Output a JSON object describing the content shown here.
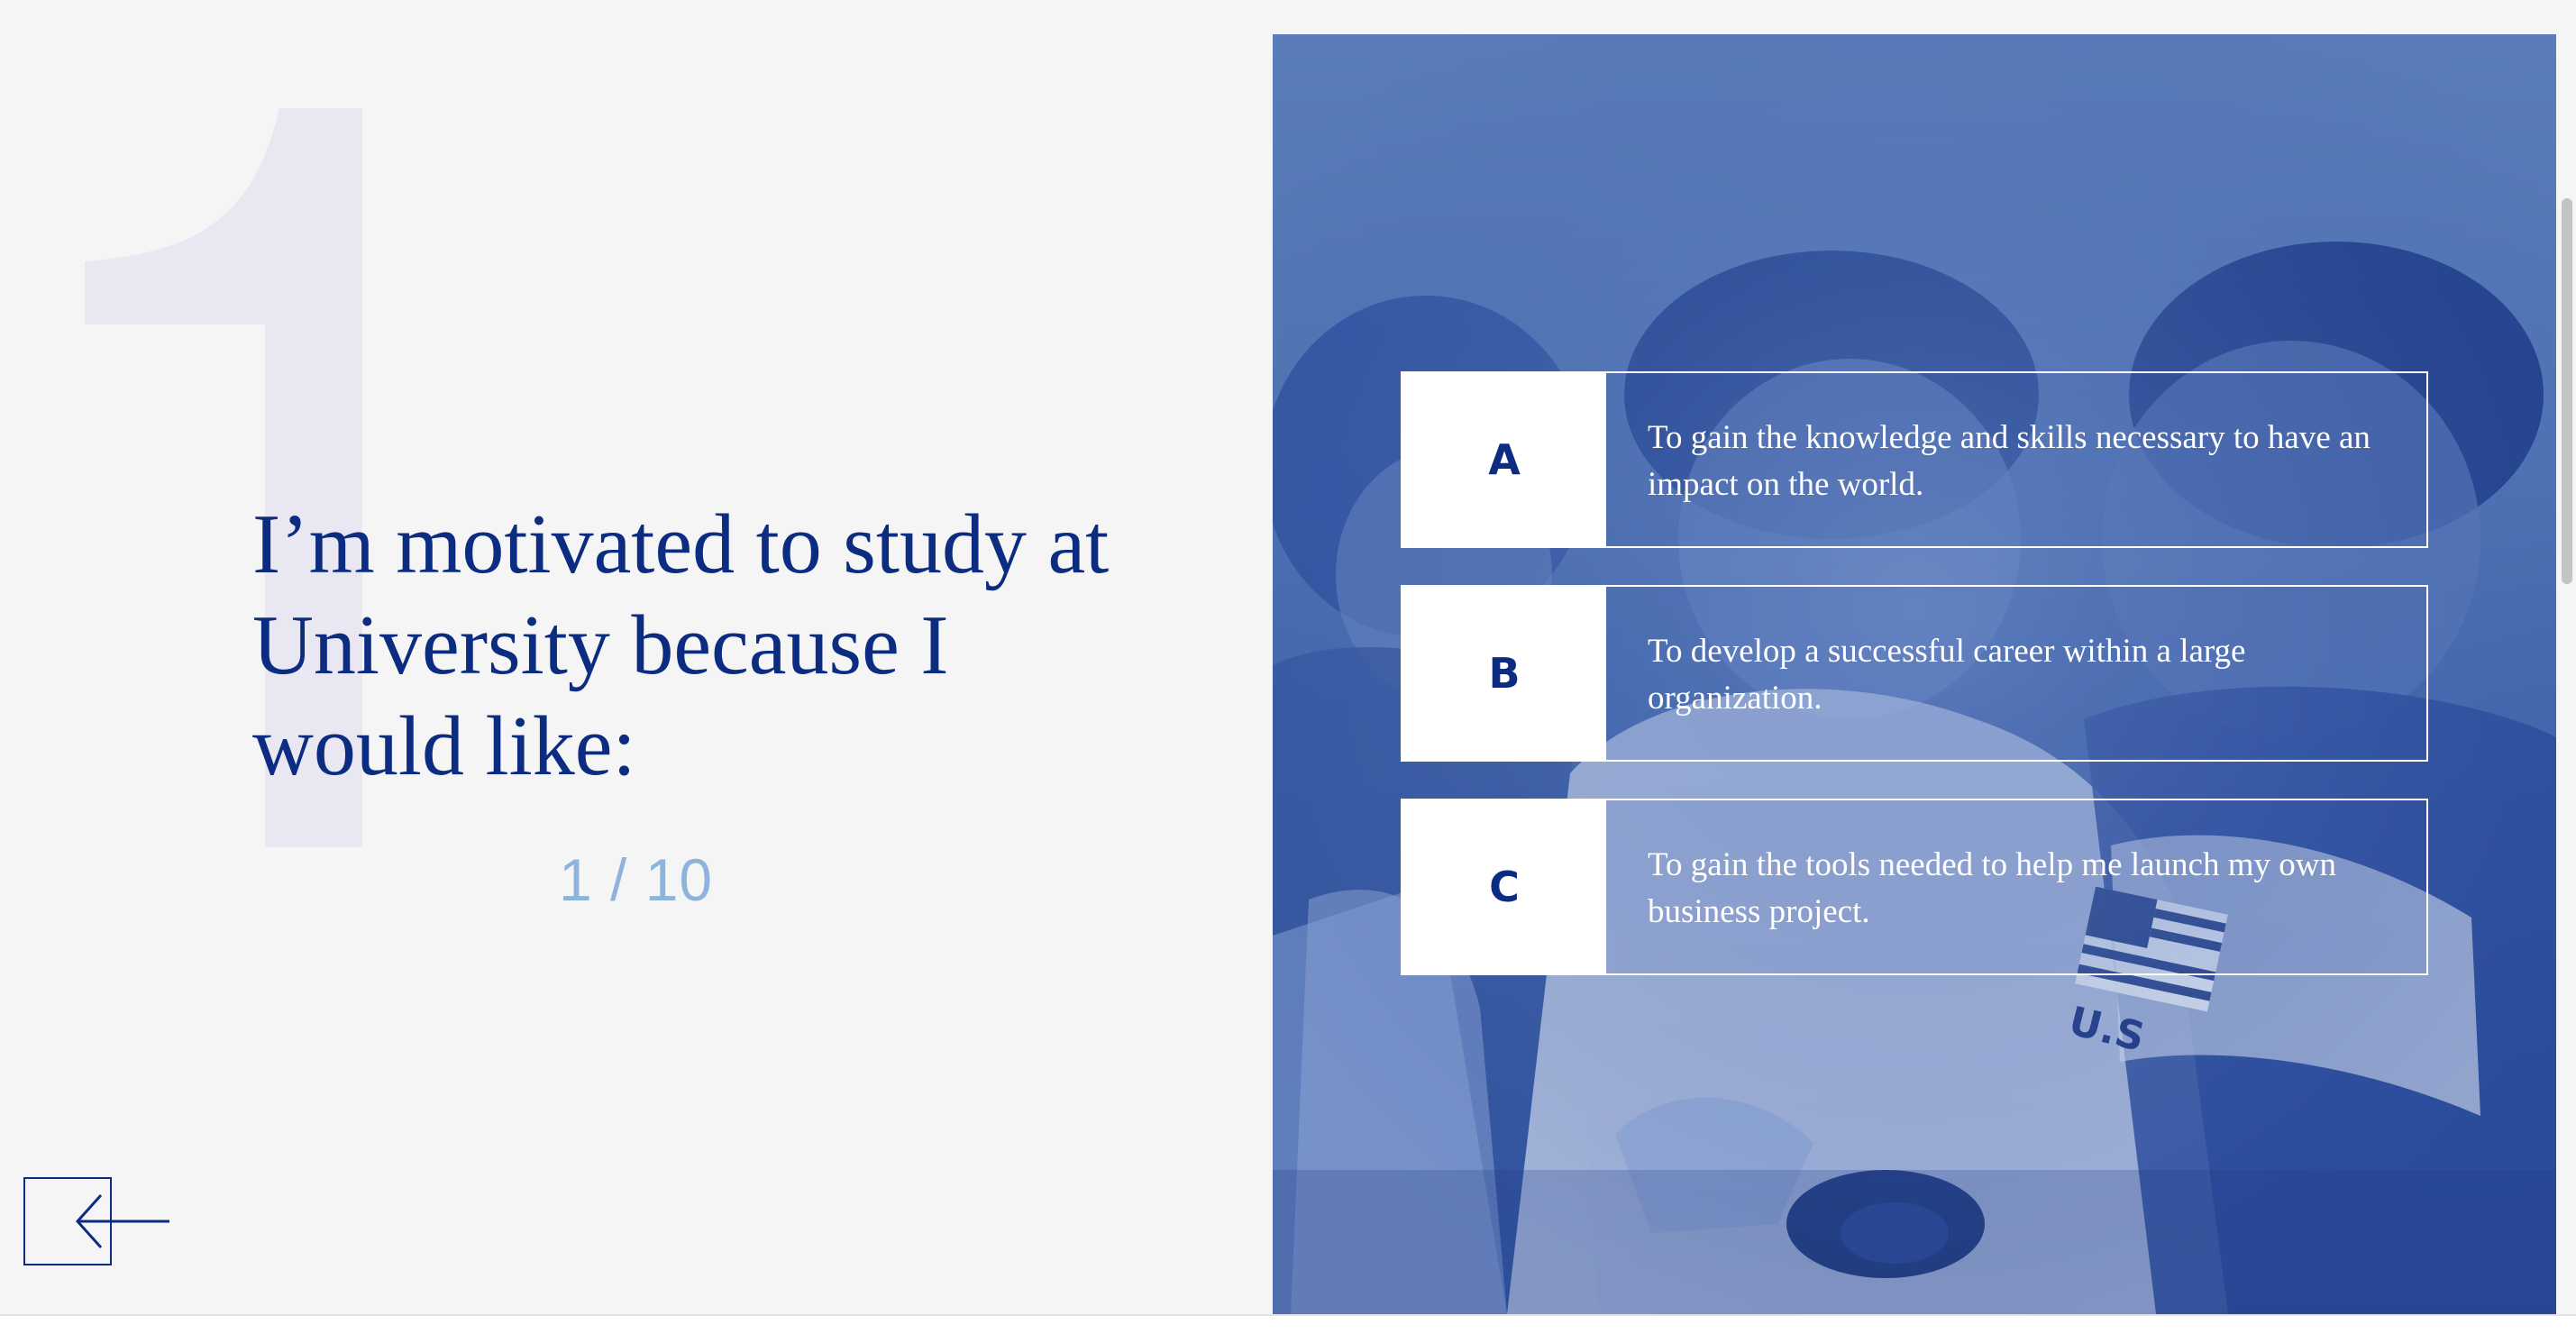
{
  "quiz": {
    "question_number": "1",
    "question_text": "I’m motivated to study at University because I would like:",
    "progress_text": "1 / 10",
    "progress": {
      "current": 1,
      "total": 10
    }
  },
  "navigation": {
    "back_icon": "arrow-left-icon"
  },
  "options": [
    {
      "letter": "A",
      "text": "To gain the knowledge and skills necessary to have an impact on the world."
    },
    {
      "letter": "B",
      "text": "To develop a successful career within a large organization."
    },
    {
      "letter": "C",
      "text": "To gain the tools needed to help me launch my own business project."
    }
  ],
  "colors": {
    "brand_navy": "#0c2c82",
    "photo_tint": "#4f73b4",
    "big_number": "#e9e7f1",
    "progress": "#8fb4dc",
    "background": "#f5f5f5"
  },
  "photo": {
    "subject": "students-working-at-laptop",
    "shirt_text": "U.S"
  }
}
